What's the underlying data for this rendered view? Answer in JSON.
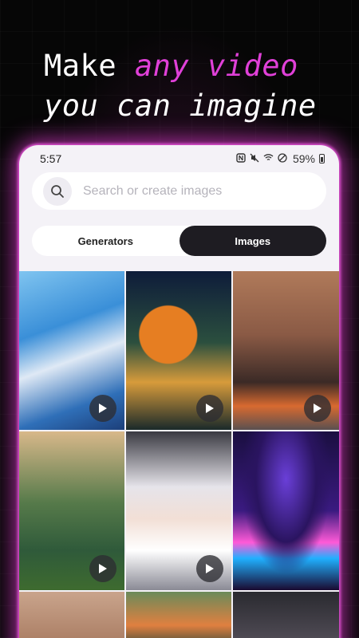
{
  "headline": {
    "word1": "Make",
    "accent": "any video",
    "line2": "you can imagine"
  },
  "status_bar": {
    "time": "5:57",
    "battery": "59%",
    "icons": [
      "nfc-icon",
      "mute-icon",
      "wifi-icon",
      "dnd-icon",
      "battery-icon"
    ]
  },
  "search": {
    "placeholder": "Search or create images"
  },
  "tabs": [
    {
      "label": "Generators",
      "active": false
    },
    {
      "label": "Images",
      "active": true
    }
  ],
  "grid": {
    "tiles": [
      {
        "subject": "anime-girl-staff-water",
        "video": true
      },
      {
        "subject": "dragon-tarot",
        "video": true
      },
      {
        "subject": "cyberpunk-woman",
        "video": true
      },
      {
        "subject": "wizard-under-tree",
        "video": true
      },
      {
        "subject": "white-haired-anime-girl",
        "video": true
      },
      {
        "subject": "neon-dance-club",
        "video": false
      },
      {
        "subject": "woman-portrait",
        "video": false
      },
      {
        "subject": "anime-boy",
        "video": false
      },
      {
        "subject": "dark-scene",
        "video": false
      }
    ]
  },
  "colors": {
    "accent": "#e040d8",
    "glow": "#e23cd2",
    "active_tab": "#1e1c22"
  }
}
